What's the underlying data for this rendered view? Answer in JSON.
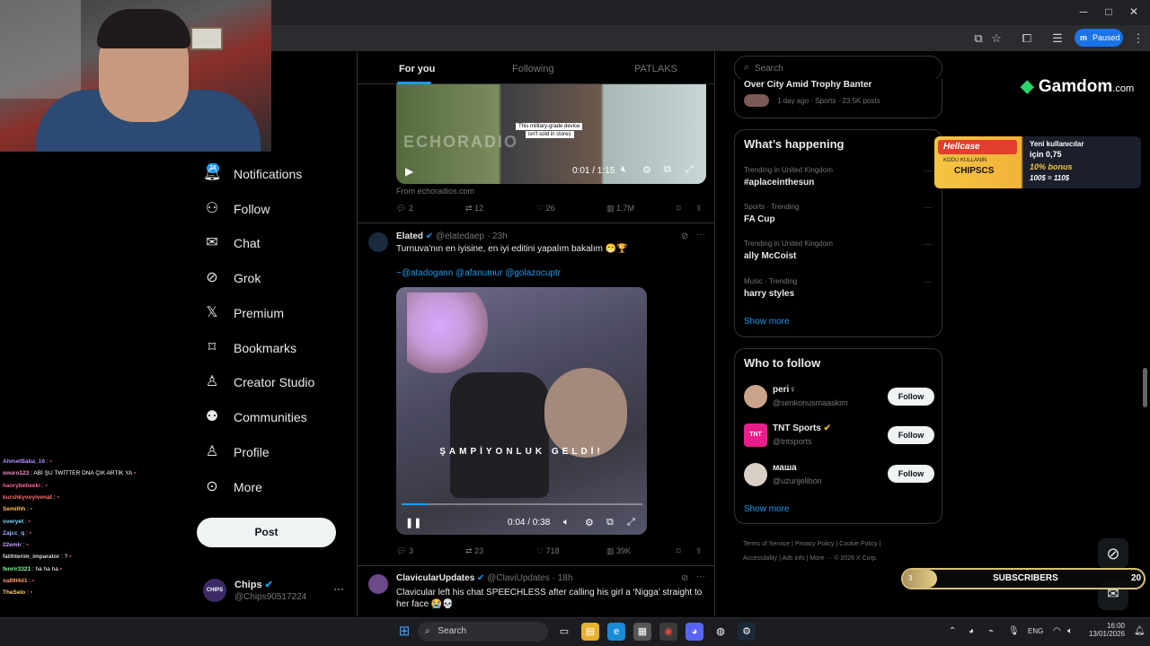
{
  "browser": {
    "window_buttons": [
      "─",
      "□",
      "✕"
    ],
    "profile_label": "Paused"
  },
  "nav": {
    "notif_count": "14",
    "items": [
      {
        "label": "Notifications",
        "icon": "bell-icon"
      },
      {
        "label": "Follow",
        "icon": "person-plus-icon"
      },
      {
        "label": "Chat",
        "icon": "envelope-icon"
      },
      {
        "label": "Grok",
        "icon": "grok-icon"
      },
      {
        "label": "Premium",
        "icon": "x-logo-icon"
      },
      {
        "label": "Bookmarks",
        "icon": "bookmark-icon"
      },
      {
        "label": "Creator Studio",
        "icon": "flask-icon"
      },
      {
        "label": "Communities",
        "icon": "people-icon"
      },
      {
        "label": "Profile",
        "icon": "person-icon"
      },
      {
        "label": "More",
        "icon": "more-circle-icon"
      }
    ],
    "post_label": "Post",
    "account": {
      "name": "Chips",
      "handle": "@Chips90517224",
      "avatar_text": "CHIPS"
    }
  },
  "chat": [
    {
      "user": "AhmetBaba_16",
      "msg": ":",
      "color": "#b48cff"
    },
    {
      "user": "onuro123",
      "msg": ": ABİ ŞU TWİTTER DNA ÇIK ARTIK YA",
      "color": "#ff8fd0"
    },
    {
      "user": "haorybebeeki",
      "msg": ":",
      "color": "#ff5f9e"
    },
    {
      "user": "kurshkyvoyivenat",
      "msg": ":",
      "color": "#ff6f6f"
    },
    {
      "user": "Semilhh",
      "msg": ":",
      "color": "#ffc25c"
    },
    {
      "user": "overyet",
      "msg": ":",
      "color": "#7dd3ff"
    },
    {
      "user": "Zajcc_q",
      "msg": ":",
      "color": "#9fb6ff"
    },
    {
      "user": "22emir",
      "msg": ":",
      "color": "#c7a0ff"
    },
    {
      "user": "fatihterim_imparator",
      "msg": ": ?",
      "color": "#d6d6d6"
    },
    {
      "user": "fenrir3321",
      "msg": ": ha ha ha",
      "color": "#7fff9b"
    },
    {
      "user": "xa89l4d1",
      "msg": ":",
      "color": "#ff9c6b"
    },
    {
      "user": "TheSelo",
      "msg": ":",
      "color": "#ffd16b"
    }
  ],
  "feed": {
    "tabs": [
      "For you",
      "Following",
      "PATLAKS"
    ],
    "tweet1": {
      "video_text_top": "This military-grade device",
      "video_text_bottom": "isn't sold in stores",
      "watermark": "ECHORADIO",
      "time": "0:01 / 1:15",
      "source": "From echoradios.com",
      "replies": "2",
      "retweets": "12",
      "likes": "26",
      "views": "1.7M"
    },
    "tweet2": {
      "name": "Elated",
      "handle": "@elatedaep",
      "time": "23h",
      "text": "Turnuva'nın en iyisine, en iyi editini yapalım bakalım 😁🏆",
      "mentions": "~@atadogann @afanumur @golazocuptr",
      "video_caption": "ŞAMPİYONLUK GELDİ!",
      "video_time": "0:04 / 0:38",
      "replies": "3",
      "retweets": "23",
      "likes": "718",
      "views": "39K"
    },
    "tweet3": {
      "name": "ClavicularUpdates",
      "handle": "@ClaviUpdates",
      "time": "18h",
      "text": "Clavicular left his chat SPEECHLESS after calling his girl a ‘Nigga’ straight to her face 😭💀"
    }
  },
  "sidebar": {
    "search_placeholder": "Search",
    "top_trend": {
      "title": "Over City Amid Trophy Banter",
      "meta": "1 day ago · Sports · 23.5K posts"
    },
    "happening": {
      "title": "What’s happening",
      "trends": [
        {
          "context": "Trending in United Kingdom",
          "name": "#aplaceinthesun"
        },
        {
          "context": "Sports · Trending",
          "name": "FA Cup"
        },
        {
          "context": "Trending in United Kingdom",
          "name": "ally McCoist"
        },
        {
          "context": "Music · Trending",
          "name": "harry styles"
        }
      ],
      "show_more": "Show more"
    },
    "who_to_follow": {
      "title": "Who to follow",
      "users": [
        {
          "name": "peri♀",
          "handle": "@senkonusmaaskim",
          "avatar_color": "#c9a48a"
        },
        {
          "name": "TNT Sports",
          "handle": "@tntsports",
          "avatar_color": "#e91e8c"
        },
        {
          "name": "маша",
          "handle": "@uzunjelibon",
          "avatar_color": "#d8cfc6"
        }
      ],
      "follow_label": "Follow",
      "show_more": "Show more"
    },
    "footer": [
      "Terms of Service",
      "Privacy Policy",
      "Cookie Policy",
      "Accessibility",
      "Ads info",
      "More ···",
      "© 2026 X Corp."
    ]
  },
  "overlays": {
    "gamdom": "Gamdom",
    "gamdom_tld": ".com",
    "hellcase": {
      "brand": "Hellcase",
      "code_label": "KODU KULLANIN",
      "code": "CHIPSCS",
      "line1": "Yeni kullanıcılar",
      "line2": "için 0,75",
      "line3": "10% bonus",
      "line4": "100$ = 110$"
    },
    "subs": {
      "left": "3",
      "label": "SUBSCRIBERS",
      "right": "20"
    }
  },
  "taskbar": {
    "search": "Search",
    "lang": "ENG",
    "time": "16:00",
    "date": "13/01/2026"
  }
}
